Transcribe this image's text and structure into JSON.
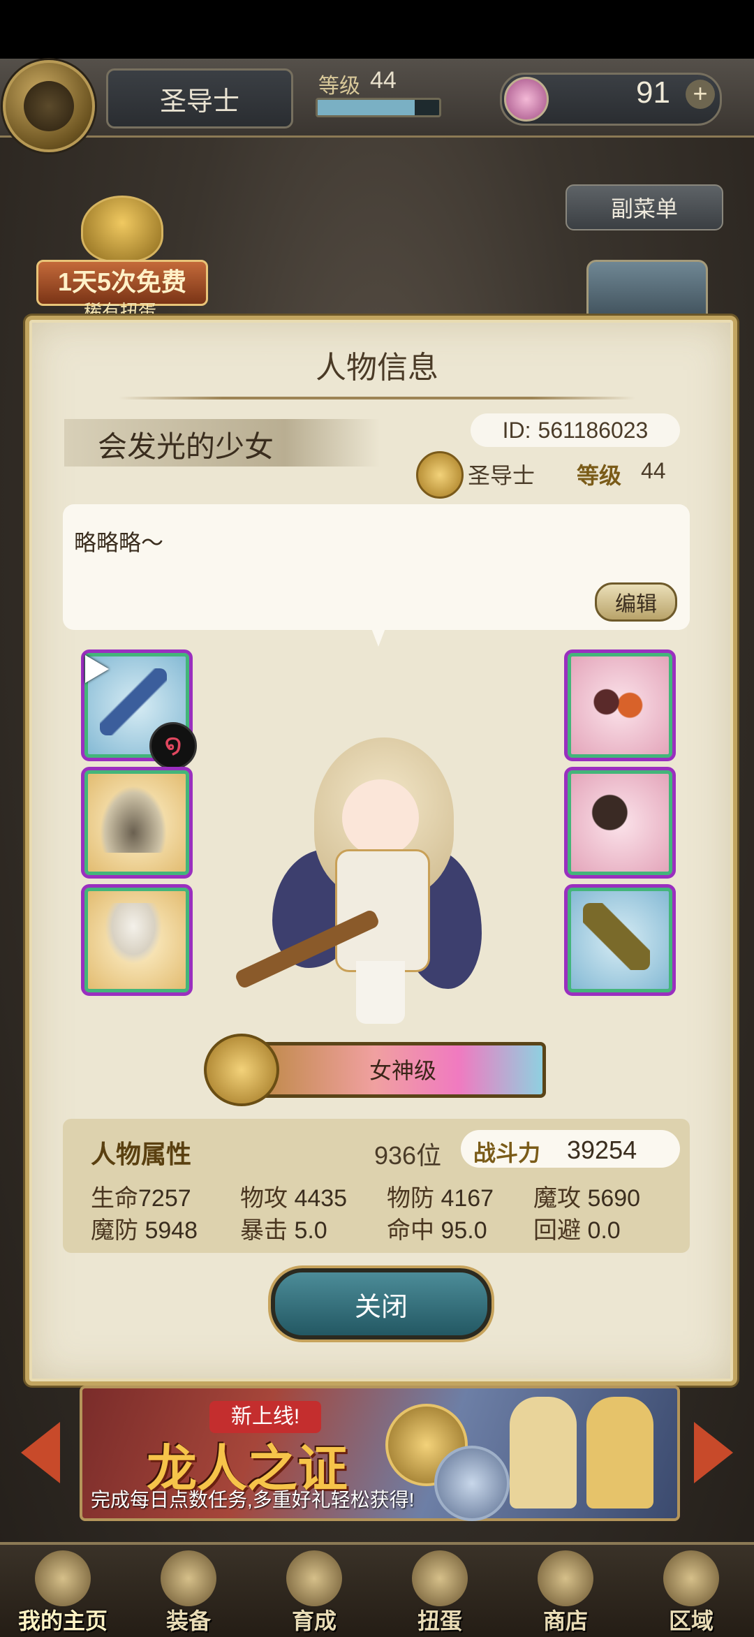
{
  "header": {
    "title": "圣导士",
    "level_label": "等级",
    "level_value": "44",
    "gems": "91",
    "plus": "+"
  },
  "submenu_label": "副菜单",
  "gacha_badge": {
    "title": "1天5次免费",
    "subtitle": "稀有扭蛋"
  },
  "dialog": {
    "title": "人物信息",
    "player_name": "会发光的少女",
    "id_label": "ID:",
    "id_value": "561186023",
    "class_name": "圣导士",
    "level_label": "等级",
    "level_value": "44",
    "comment": "略略略〜",
    "edit_label": "编辑",
    "rank_tier": "女神级",
    "attributes": {
      "title": "人物属性",
      "rank_position": "936位",
      "power_label": "战斗力",
      "power_value": "39254",
      "stats": [
        {
          "key": "生命",
          "value": "7257"
        },
        {
          "key": "物攻",
          "value": "4435"
        },
        {
          "key": "物防",
          "value": "4167"
        },
        {
          "key": "魔攻",
          "value": "5690"
        },
        {
          "key": "魔防",
          "value": "5948"
        },
        {
          "key": "暴击",
          "value": "5.0"
        },
        {
          "key": "命中",
          "value": "95.0"
        },
        {
          "key": "回避",
          "value": "0.0"
        }
      ]
    },
    "close_label": "关闭",
    "equipment_left": [
      "mace-icon",
      "robe-icon",
      "skirt-icon"
    ],
    "equipment_right": [
      "horns-icon",
      "claw-icon",
      "charm-icon"
    ]
  },
  "banner": {
    "tag": "新上线!",
    "title": "龙人之证",
    "subtitle": "完成每日点数任务,多重好礼轻松获得!"
  },
  "nav": [
    {
      "label": "我的主页",
      "icon": "scroll-icon"
    },
    {
      "label": "装备",
      "icon": "helmet-icon"
    },
    {
      "label": "育成",
      "icon": "swords-icon"
    },
    {
      "label": "扭蛋",
      "icon": "gacha-pot-icon"
    },
    {
      "label": "商店",
      "icon": "shop-icon"
    },
    {
      "label": "区域",
      "icon": "globe-icon"
    }
  ],
  "colors": {
    "accent": "#c2a560",
    "slot_border": "#9a2fbf",
    "close_button": "#235863"
  }
}
